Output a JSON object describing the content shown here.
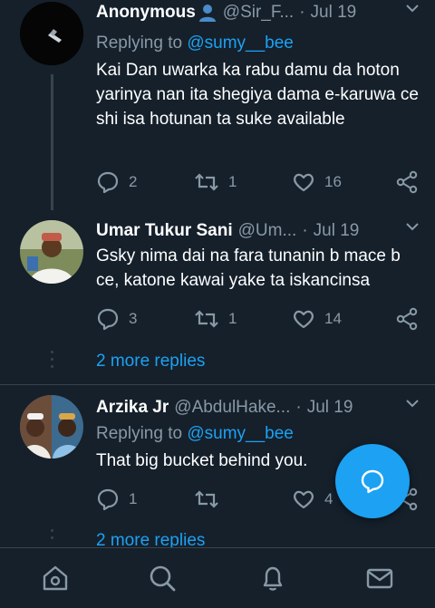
{
  "colors": {
    "background": "#15202b",
    "accent": "#1da1f2",
    "muted": "#8899a6",
    "divider": "#38444d"
  },
  "tweets": [
    {
      "name": "Anonymous",
      "name_emoji_icon": "bust-in-silhouette-icon",
      "handle": "@Sir_F...",
      "separator": "·",
      "date": "Jul 19",
      "replying_prefix": "Replying to",
      "replying_to": "@sumy__bee",
      "text": "Kai Dan uwarka ka rabu damu da hoton yarinya nan ita shegiya dama e-karuwa ce shi isa hotunan ta suke available",
      "replies": "2",
      "retweets": "1",
      "likes": "16"
    },
    {
      "name": "Umar Tukur Sani",
      "handle": "@Um...",
      "separator": "·",
      "date": "Jul 19",
      "text": "Gsky nima dai na fara tunanin b mace b ce, katone kawai yake ta iskancinsa",
      "replies": "3",
      "retweets": "1",
      "likes": "14"
    },
    {
      "name": "Arzika Jr",
      "handle": "@AbdulHake...",
      "separator": "·",
      "date": "Jul 19",
      "replying_prefix": "Replying to",
      "replying_to": "@sumy__bee",
      "text": "That big bucket behind you.",
      "replies": "1",
      "retweets": "",
      "likes": "4"
    }
  ],
  "more_replies": [
    "2 more replies",
    "2 more replies"
  ],
  "fab_icon": "compose-reply-icon",
  "nav": [
    "home-icon",
    "search-icon",
    "notifications-icon",
    "messages-icon"
  ]
}
